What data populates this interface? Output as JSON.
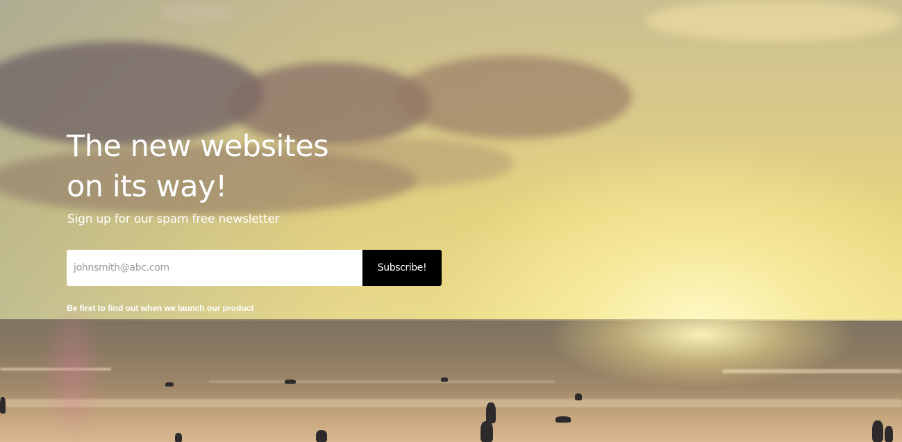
{
  "hero": {
    "title_line1": "The new websites",
    "title_line2": "on its way!",
    "subtitle": "Sign up for our spam free newsletter",
    "note": "Be first to find out when we launch our product"
  },
  "form": {
    "email_placeholder": "johnsmith@abc.com",
    "email_value": "",
    "subscribe_label": "Subscribe!"
  },
  "colors": {
    "button_background": "#000000",
    "input_background": "#ffffff",
    "text": "#ffffff"
  }
}
